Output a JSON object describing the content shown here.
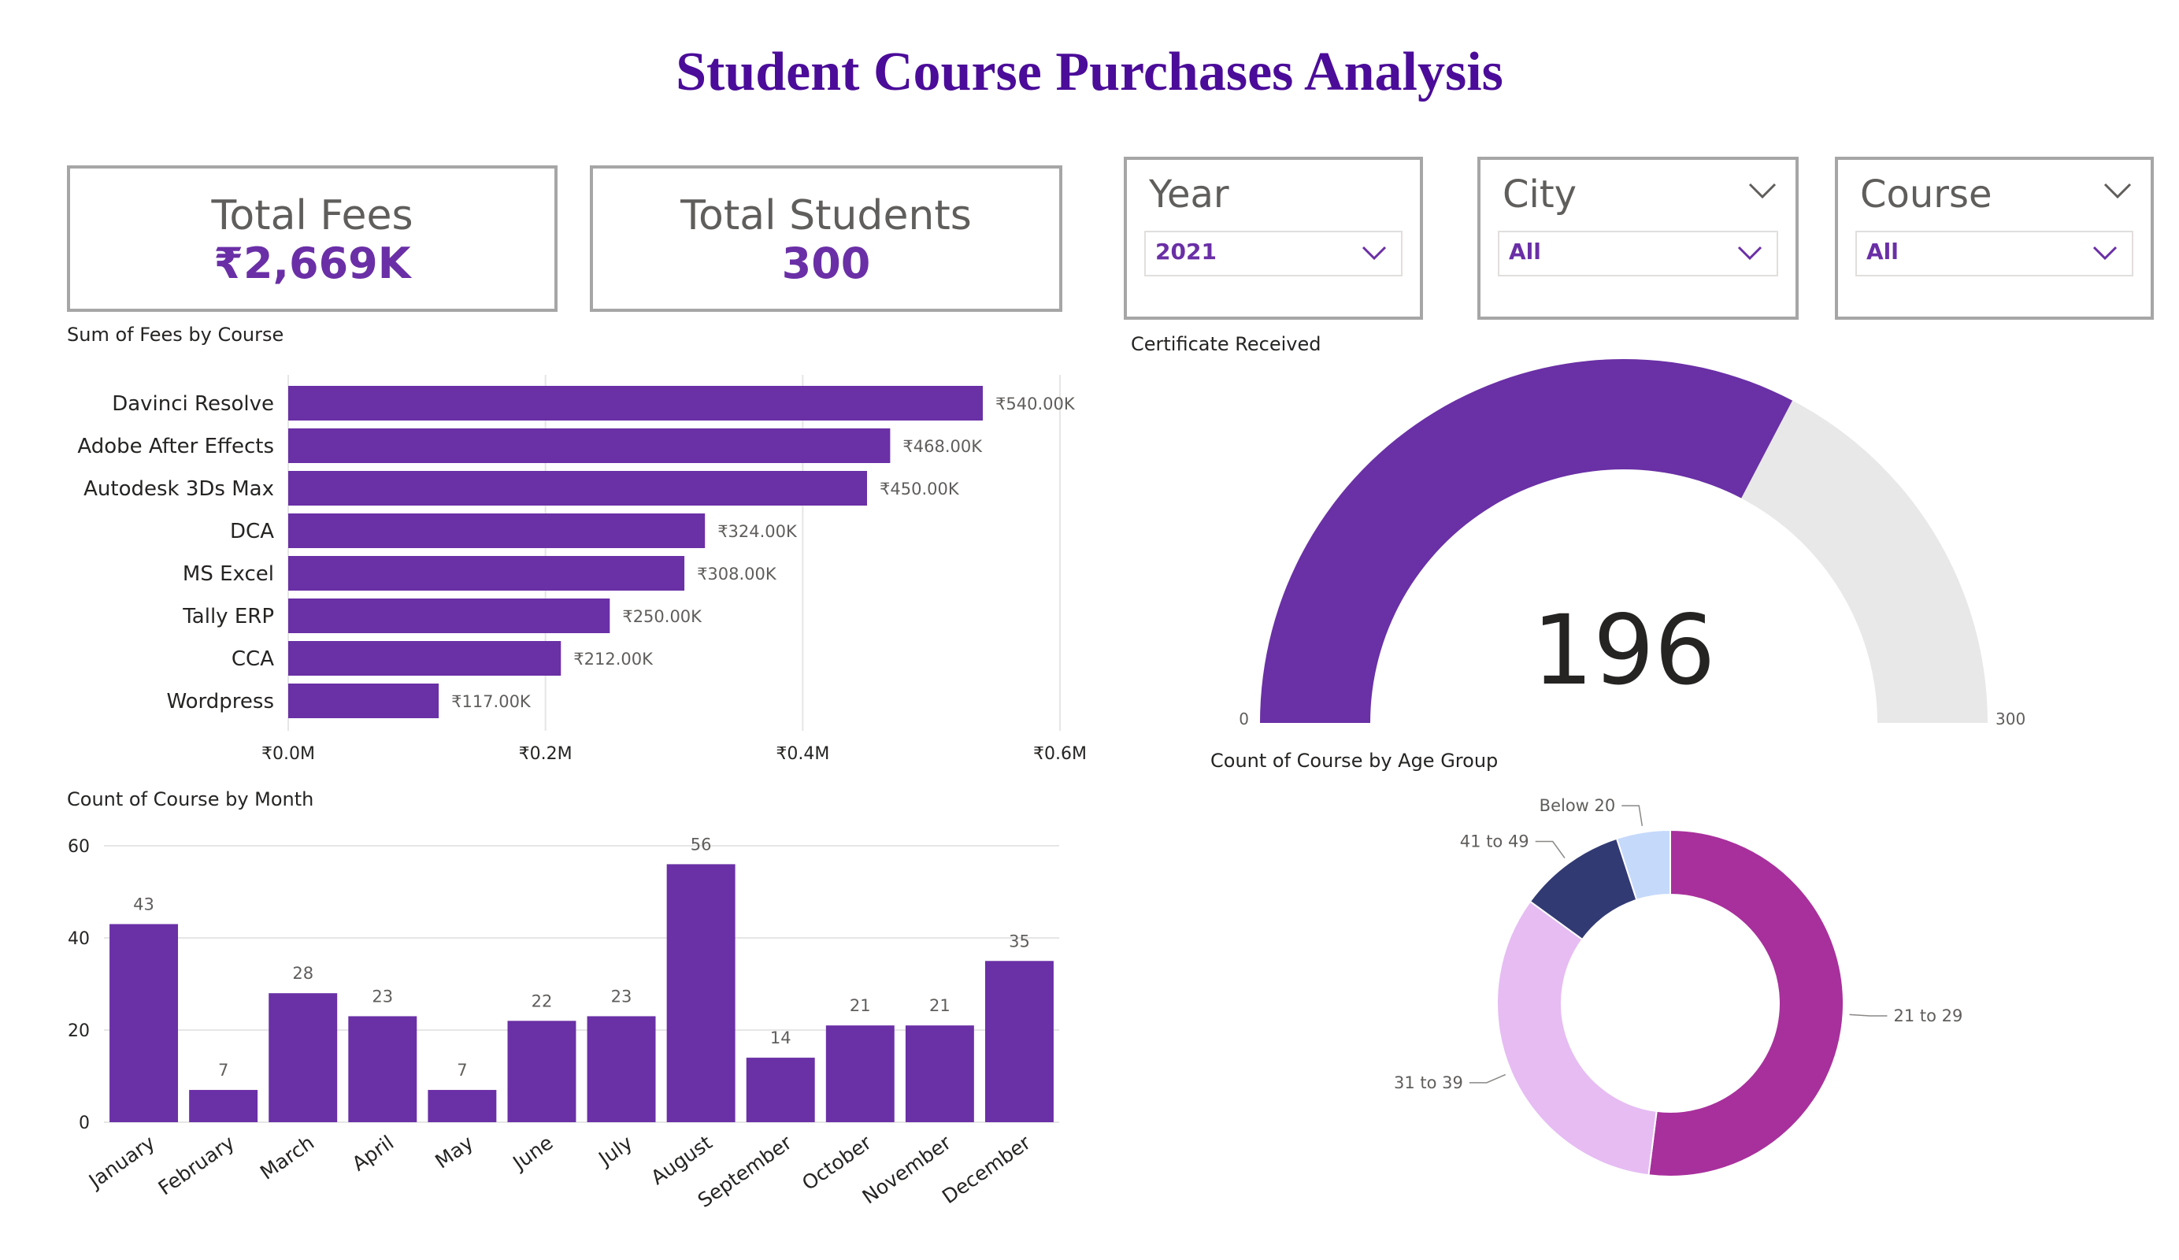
{
  "title": "Student Course Purchases Analysis",
  "kpis": {
    "total_fees": {
      "label": "Total Fees",
      "value": "₹2,669K"
    },
    "total_students": {
      "label": "Total Students",
      "value": "300"
    }
  },
  "slicers": {
    "year": {
      "title": "Year",
      "value": "2021"
    },
    "city": {
      "title": "City",
      "value": "All"
    },
    "course": {
      "title": "Course",
      "value": "All"
    }
  },
  "colors": {
    "accent": "#6a30a6",
    "title": "#4b0c99",
    "gauge_bg": "#e8e8e8",
    "grid": "#e6e6e6"
  },
  "icons": {
    "slicer_dropdown": "chevron-down-icon"
  },
  "chart_data": [
    {
      "type": "bar",
      "orientation": "horizontal",
      "title": "Sum of Fees by Course",
      "categories": [
        "Davinci Resolve",
        "Adobe After Effects",
        "Autodesk 3Ds Max",
        "DCA",
        "MS Excel",
        "Tally ERP",
        "CCA",
        "Wordpress"
      ],
      "values": [
        540000,
        468000,
        450000,
        324000,
        308000,
        250000,
        212000,
        117000
      ],
      "data_labels": [
        "₹540.00K",
        "₹468.00K",
        "₹450.00K",
        "₹324.00K",
        "₹308.00K",
        "₹250.00K",
        "₹212.00K",
        "₹117.00K"
      ],
      "x_ticks": [
        0,
        200000,
        400000,
        600000
      ],
      "x_tick_labels": [
        "₹0.0M",
        "₹0.2M",
        "₹0.4M",
        "₹0.6M"
      ],
      "xlim": [
        0,
        600000
      ],
      "grid": true
    },
    {
      "type": "gauge",
      "title": "Certificate Received",
      "value": 196,
      "min": 0,
      "max": 300,
      "value_label": "196",
      "min_label": "0",
      "max_label": "300"
    },
    {
      "type": "bar",
      "title": "Count of Course by Month",
      "categories": [
        "January",
        "February",
        "March",
        "April",
        "May",
        "June",
        "July",
        "August",
        "September",
        "October",
        "November",
        "December"
      ],
      "values": [
        43,
        7,
        28,
        23,
        7,
        22,
        23,
        56,
        14,
        21,
        21,
        35
      ],
      "y_ticks": [
        0,
        20,
        40,
        60
      ],
      "y_tick_labels": [
        "0",
        "20",
        "40",
        "60"
      ],
      "ylim": [
        0,
        60
      ],
      "grid": true
    },
    {
      "type": "pie",
      "style": "donut",
      "title": "Count of Course by Age Group",
      "labels": [
        "21 to 29",
        "31 to 39",
        "41 to 49",
        "Below 20"
      ],
      "values": [
        52,
        33,
        10,
        5
      ],
      "colors": [
        "#a8309c",
        "#e6bcf3",
        "#323a73",
        "#c5d9fb"
      ]
    }
  ]
}
